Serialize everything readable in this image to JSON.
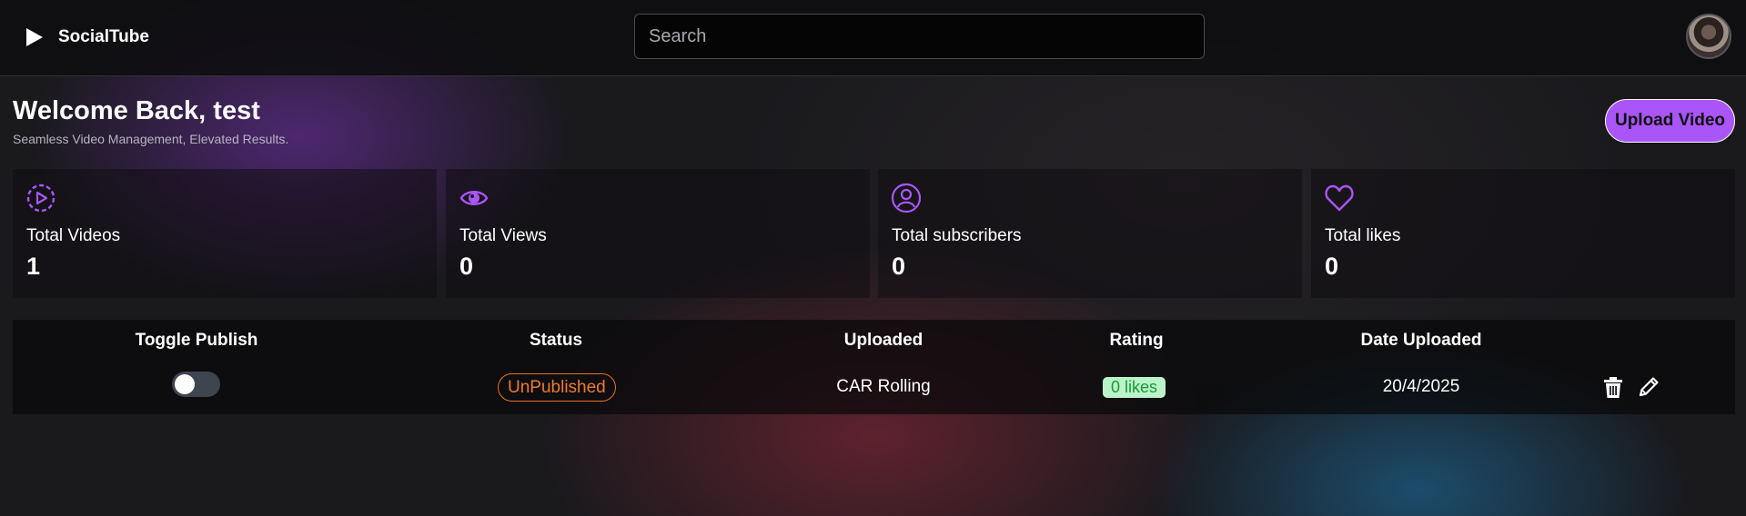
{
  "app": {
    "name": "SocialTube"
  },
  "search": {
    "placeholder": "Search",
    "value": ""
  },
  "header": {
    "welcome": "Welcome Back, test",
    "tagline": "Seamless Video Management, Elevated Results.",
    "upload_label": "Upload Video"
  },
  "stats": [
    {
      "label": "Total Videos",
      "value": "1",
      "icon": "play-circle-icon"
    },
    {
      "label": "Total Views",
      "value": "0",
      "icon": "eye-icon"
    },
    {
      "label": "Total subscribers",
      "value": "0",
      "icon": "user-icon"
    },
    {
      "label": "Total likes",
      "value": "0",
      "icon": "heart-icon"
    }
  ],
  "table": {
    "columns": [
      "Toggle Publish",
      "Status",
      "Uploaded",
      "Rating",
      "Date Uploaded"
    ],
    "rows": [
      {
        "published": false,
        "status": "UnPublished",
        "title": "CAR Rolling",
        "rating": "0 likes",
        "date": "20/4/2025"
      }
    ]
  },
  "colors": {
    "accent": "#a955f7",
    "status_unpublished": "#f07a2e",
    "likes_bg": "#bbf3c8",
    "likes_text": "#189a3b"
  }
}
